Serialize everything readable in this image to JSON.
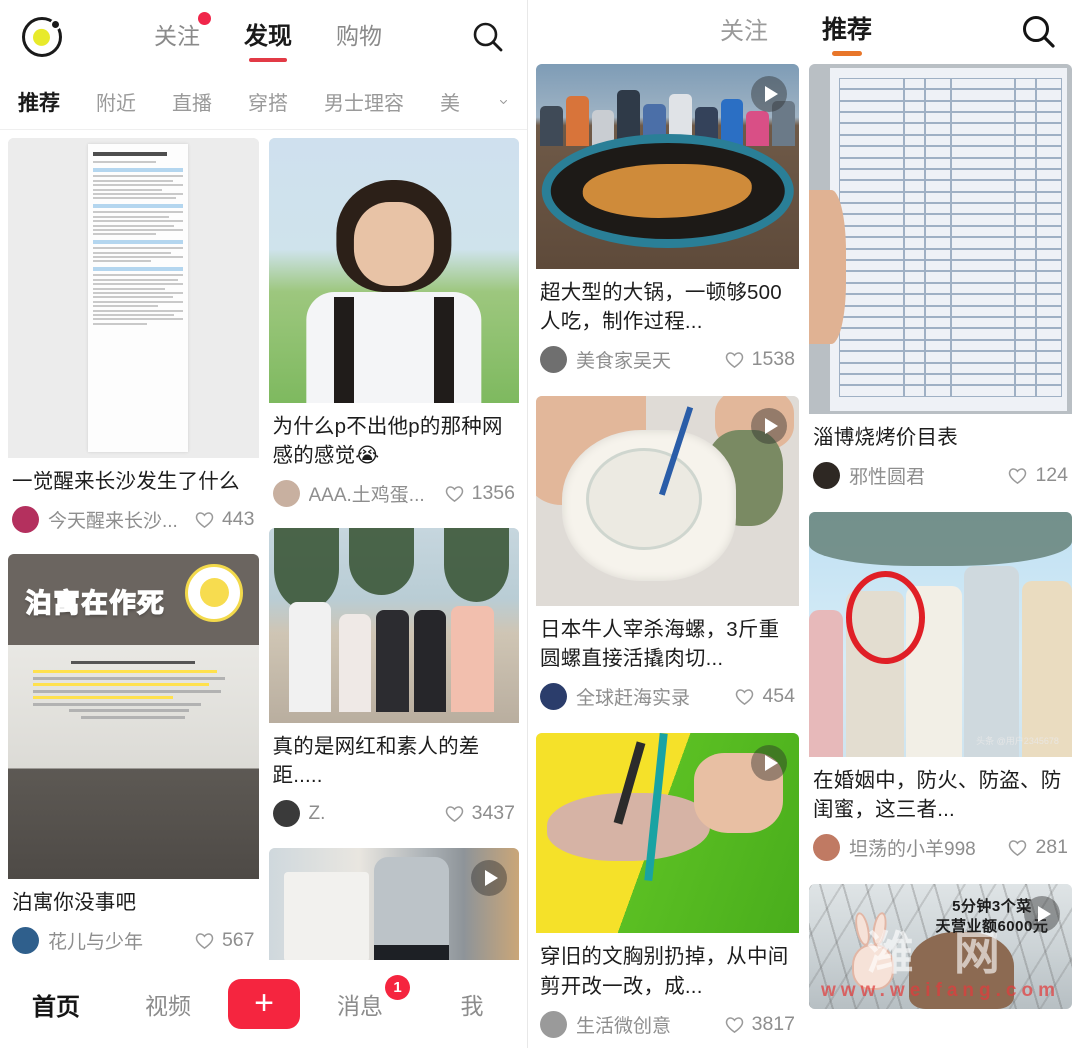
{
  "left_app": {
    "logo_icon": "app-logo-icon",
    "top_tabs": [
      {
        "label": "关注",
        "active": false,
        "badge": true
      },
      {
        "label": "发现",
        "active": true,
        "badge": false
      },
      {
        "label": "购物",
        "active": false,
        "badge": false
      }
    ],
    "search_icon": "search-icon",
    "sub_tabs": [
      {
        "label": "推荐",
        "active": true
      },
      {
        "label": "附近",
        "active": false
      },
      {
        "label": "直播",
        "active": false
      },
      {
        "label": "穿搭",
        "active": false
      },
      {
        "label": "男士理容",
        "active": false
      },
      {
        "label": "美",
        "active": false
      }
    ],
    "expand_icon": "chevron-down-icon",
    "column_left": [
      {
        "title": "一觉醒来长沙发生了什么",
        "author": "今天醒来长沙...",
        "likes": "443",
        "media": "document-screenshot",
        "has_video": false,
        "doc_heading": "今天醒来长沙都发生了什么"
      },
      {
        "title": "泊寓你没事吧",
        "author": "花儿与少年",
        "likes": "567",
        "media": "poster-photo",
        "has_video": false,
        "overlay_text": "泊寓在作死"
      }
    ],
    "column_right": [
      {
        "title": "为什么p不出他p的那种网感的感觉😭",
        "author": "AAA.土鸡蛋...",
        "likes": "1356",
        "media": "portrait-photo",
        "has_video": false
      },
      {
        "title": "真的是网红和素人的差距.....",
        "author": "Z.",
        "likes": "3437",
        "media": "beach-group-photo",
        "has_video": false
      },
      {
        "title": "",
        "author": "",
        "likes": "",
        "media": "clothing-store-photo",
        "has_video": true
      }
    ],
    "bottom_nav": [
      {
        "label": "首页",
        "active": true,
        "badge": ""
      },
      {
        "label": "视频",
        "active": false,
        "badge": ""
      },
      {
        "label": "消息",
        "active": false,
        "badge": "1"
      },
      {
        "label": "我",
        "active": false,
        "badge": ""
      }
    ],
    "compose_label": "+"
  },
  "right_app": {
    "top_tabs": [
      {
        "label": "关注",
        "active": false
      },
      {
        "label": "推荐",
        "active": true
      }
    ],
    "search_icon": "search-icon",
    "column_left": [
      {
        "title": "超大型的大锅，一顿够500人吃，制作过程...",
        "author": "美食家吴天",
        "likes": "1538",
        "media": "giant-wok-photo",
        "has_video": true
      },
      {
        "title": "日本牛人宰杀海螺，3斤重圆螺直接活撬肉切...",
        "author": "全球赶海实录",
        "likes": "454",
        "media": "sea-snail-photo",
        "has_video": true
      },
      {
        "title": "穿旧的文胸别扔掉，从中间剪开改一改，成...",
        "author": "生活微创意",
        "likes": "3817",
        "media": "diy-craft-photo",
        "has_video": true
      }
    ],
    "column_right": [
      {
        "title": "淄博烧烤价目表",
        "author": "邪性圆君",
        "likes": "124",
        "media": "price-list-photo",
        "has_video": false
      },
      {
        "title": "在婚姻中，防火、防盗、防闺蜜，这三者...",
        "author": "坦荡的小羊998",
        "likes": "281",
        "media": "wedding-group-photo",
        "has_video": false,
        "watermark": "头条 @用户2345678"
      },
      {
        "title": "",
        "author": "",
        "likes": "",
        "media": "cooking-video-thumbnail",
        "has_video": true,
        "overlay_line1": "5分钟3个菜",
        "overlay_line2": "天营业额6000元",
        "watermark_big": "潍 网",
        "watermark_small": "www.weifang.com"
      }
    ]
  },
  "colors": {
    "accent_red": "#e23a46",
    "accent_orange": "#e8762a",
    "compose_red": "#f5253f",
    "badge_red": "#f0264a",
    "text_primary": "#1d1d1d",
    "text_secondary": "#8e8e8e"
  }
}
